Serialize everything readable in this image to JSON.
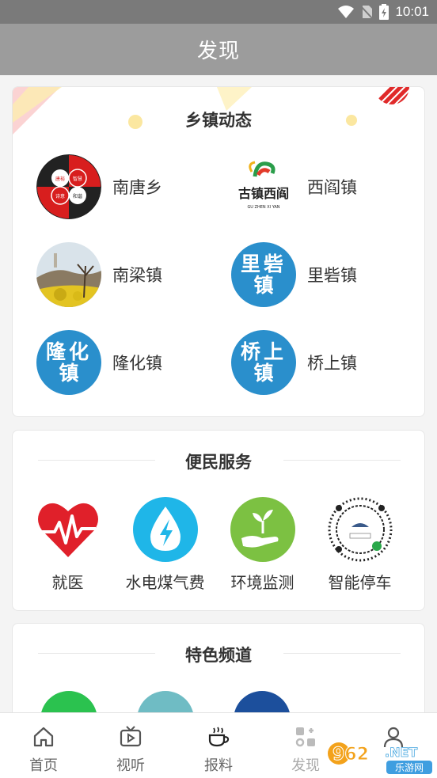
{
  "status_bar": {
    "time": "10:01"
  },
  "header": {
    "title": "发现"
  },
  "towns": {
    "title": "乡镇动态",
    "items": [
      {
        "name": "南唐乡",
        "logo_cells": [
          "唐裕",
          "智慧",
          "诗意",
          "和谐"
        ]
      },
      {
        "name": "西阎镇",
        "logo_text": "古镇西阎",
        "logo_sub": "GU ZHEN XI YAN"
      },
      {
        "name": "南梁镇"
      },
      {
        "name": "里砦镇",
        "badge_l1": "里砦",
        "badge_l2": "镇"
      },
      {
        "name": "隆化镇",
        "badge_l1": "隆化",
        "badge_l2": "镇"
      },
      {
        "name": "桥上镇",
        "badge_l1": "桥上",
        "badge_l2": "镇"
      }
    ]
  },
  "services": {
    "title": "便民服务",
    "items": [
      {
        "label": "就医",
        "icon": "heart-pulse-icon"
      },
      {
        "label": "水电煤气费",
        "icon": "water-energy-icon"
      },
      {
        "label": "环境监测",
        "icon": "hand-sprout-icon"
      },
      {
        "label": "智能停车",
        "icon": "qr-code-icon"
      }
    ]
  },
  "special": {
    "title": "特色频道"
  },
  "tabbar": {
    "items": [
      {
        "label": "首页",
        "icon": "home-icon"
      },
      {
        "label": "视听",
        "icon": "tv-icon"
      },
      {
        "label": "报料",
        "icon": "coffee-icon"
      },
      {
        "label": "发现",
        "icon": "discover-icon",
        "active": true
      },
      {
        "label": "",
        "icon": "user-icon"
      }
    ]
  },
  "watermark": {
    "text": "962",
    "suffix": ".NET",
    "sub": "乐游网"
  },
  "colors": {
    "header": "#9c9c9c",
    "status": "#7a7a7a",
    "badge_blue": "#2a8fcc",
    "heart_red": "#e0202a",
    "water_blue": "#1fb6e8",
    "leaf_green": "#7cc142"
  }
}
